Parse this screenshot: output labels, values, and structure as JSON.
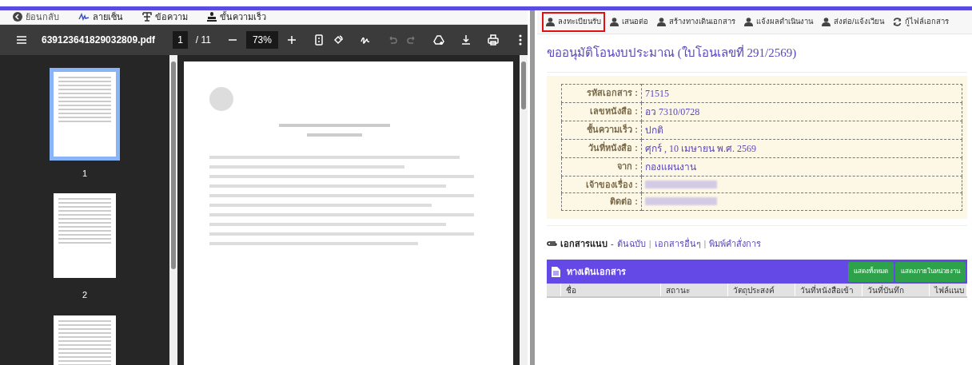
{
  "left_toolbar": [
    {
      "kind": "back",
      "label": "ย้อนกลับ"
    },
    {
      "kind": "signature",
      "label": "ลายเซ็น"
    },
    {
      "kind": "text",
      "label": "ข้อความ"
    },
    {
      "kind": "stamp",
      "label": "ขั้นความเร็ว"
    }
  ],
  "pdf_viewer": {
    "filename": "639123641829032809.pdf",
    "page": "1",
    "page_count": "/ 11",
    "zoom": "73%",
    "undo_disabled": true,
    "redo_disabled": true,
    "thumbnails": [
      {
        "label": "1",
        "selected": true
      },
      {
        "label": "2",
        "selected": false
      },
      {
        "selected": false
      }
    ]
  },
  "right_nav": [
    {
      "kind": "user",
      "label": "ลงทะเบียนรับ",
      "highlighted": true
    },
    {
      "kind": "user",
      "label": "เสนอต่อ",
      "highlighted": false
    },
    {
      "kind": "user",
      "label": "สร้างทางเดินเอกสาร",
      "highlighted": false
    },
    {
      "kind": "user",
      "label": "แจ้งผลดำเนินงาน",
      "highlighted": false
    },
    {
      "kind": "user",
      "label": "ส่งต่อ/แจ้งเวียน",
      "highlighted": false
    },
    {
      "kind": "refresh",
      "label": "กู้ไฟล์เอกสาร",
      "highlighted": false
    }
  ],
  "document": {
    "title": "ขออนุมัติโอนงบประมาณ (ใบโอนเลขที่ 291/2569)",
    "fields": [
      {
        "label": "รหัสเอกสาร :",
        "value": "71515"
      },
      {
        "label": "เลขหนังสือ :",
        "value": "อว 7310/0728"
      },
      {
        "label": "ชั้นความเร็ว :",
        "value": "ปกติ"
      },
      {
        "label": "วันที่หนังสือ :",
        "value": "ศุกร์ , 10 เมษายน พ.ศ. 2569"
      },
      {
        "label": "จาก :",
        "value": "กองแผนงาน"
      },
      {
        "label": "เจ้าของเรื่อง :",
        "redacted": true
      },
      {
        "label": "ติดต่อ :",
        "redacted": true
      }
    ]
  },
  "attachments": {
    "label": "เอกสารแนบ",
    "dash": "-",
    "separator": "|",
    "links": [
      "ต้นฉบับ",
      "เอกสารอื่นๆ",
      "พิมพ์คำสั่งการ"
    ]
  },
  "route_panel": {
    "title": "ทางเดินเอกสาร",
    "buttons": [
      "แสดงทั้งหมด",
      "แสดงภายในหน่วยงาน"
    ],
    "columns": [
      "ชื่อ",
      "สถานะ",
      "วัตถุประสงค์",
      "วันที่หนังสือเข้า",
      "วันที่บันทึก",
      "ไฟล์แนบ"
    ]
  }
}
